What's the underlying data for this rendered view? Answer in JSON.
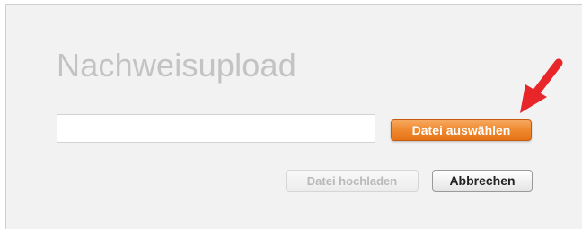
{
  "dialog": {
    "title": "Nachweisupload",
    "file_input": {
      "value": "",
      "placeholder": ""
    },
    "choose_button_label": "Datei auswählen",
    "upload_button_label": "Datei hochladen",
    "cancel_button_label": "Abbrechen"
  },
  "colors": {
    "accent_orange": "#ef8a30",
    "annotation_arrow": "#e8262a",
    "title_text": "#c3c3c3",
    "disabled_text": "#b9b9b9"
  },
  "annotation": {
    "icon": "red-arrow-pointer",
    "points_to": "Datei auswählen"
  }
}
